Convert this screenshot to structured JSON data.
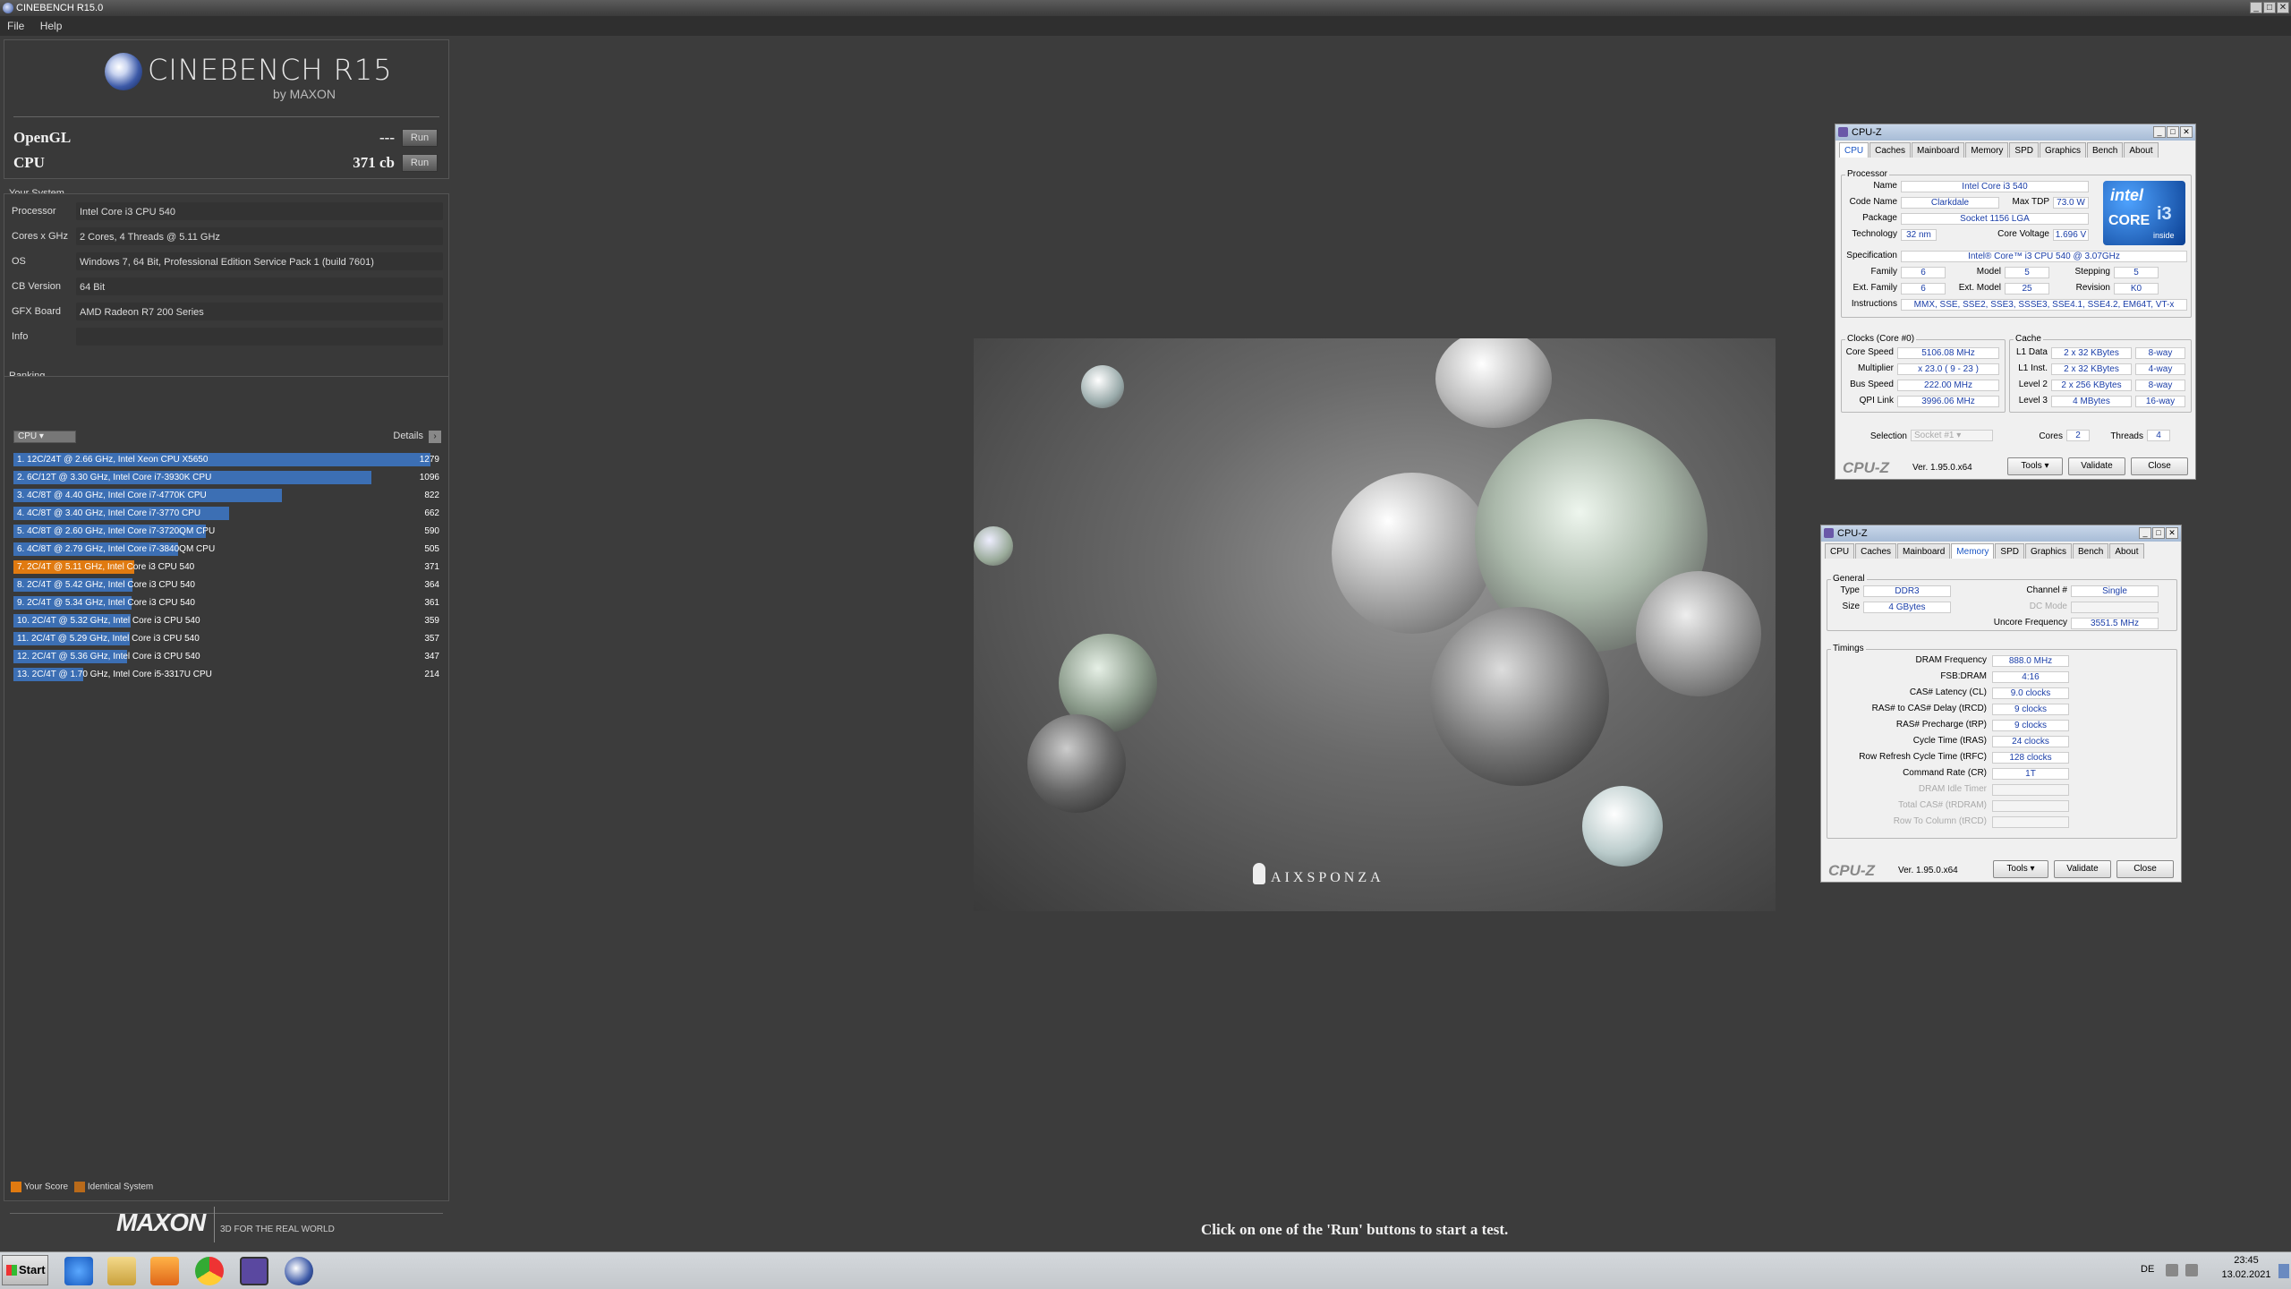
{
  "window": {
    "title": "CINEBENCH R15.0"
  },
  "menu": [
    "File",
    "Help"
  ],
  "logo": {
    "title": "CINEBENCH R15",
    "by": "by MAXON"
  },
  "bench": {
    "opengl": {
      "label": "OpenGL",
      "score": "---",
      "run": "Run"
    },
    "cpu": {
      "label": "CPU",
      "score": "371 cb",
      "run": "Run"
    }
  },
  "system": {
    "heading": "Your System",
    "rows": [
      {
        "k": "Processor",
        "v": "Intel Core i3 CPU 540"
      },
      {
        "k": "Cores x GHz",
        "v": "2 Cores, 4 Threads @ 5.11 GHz"
      },
      {
        "k": "OS",
        "v": "Windows 7, 64 Bit, Professional Edition Service Pack 1 (build 7601)"
      },
      {
        "k": "CB Version",
        "v": "64 Bit"
      },
      {
        "k": "GFX Board",
        "v": "AMD Radeon R7 200 Series"
      },
      {
        "k": "Info",
        "v": ""
      }
    ]
  },
  "ranking": {
    "heading": "Ranking",
    "selector": "CPU",
    "details": "Details",
    "max": 1279,
    "rows": [
      {
        "label": "1. 12C/24T @ 2.66 GHz, Intel Xeon CPU X5650",
        "score": 1279,
        "hl": false
      },
      {
        "label": "2. 6C/12T @ 3.30 GHz,  Intel Core i7-3930K CPU",
        "score": 1096,
        "hl": false
      },
      {
        "label": "3. 4C/8T @ 4.40 GHz, Intel Core i7-4770K CPU",
        "score": 822,
        "hl": false
      },
      {
        "label": "4. 4C/8T @ 3.40 GHz,  Intel Core i7-3770 CPU",
        "score": 662,
        "hl": false
      },
      {
        "label": "5. 4C/8T @ 2.60 GHz, Intel Core i7-3720QM CPU",
        "score": 590,
        "hl": false
      },
      {
        "label": "6. 4C/8T @ 2.79 GHz,  Intel Core i7-3840QM CPU",
        "score": 505,
        "hl": false
      },
      {
        "label": "7. 2C/4T @ 5.11 GHz, Intel Core i3 CPU 540",
        "score": 371,
        "hl": true
      },
      {
        "label": "8. 2C/4T @ 5.42 GHz, Intel Core i3 CPU 540",
        "score": 364,
        "hl": false
      },
      {
        "label": "9. 2C/4T @ 5.34 GHz, Intel Core i3 CPU 540",
        "score": 361,
        "hl": false
      },
      {
        "label": "10. 2C/4T @ 5.32 GHz, Intel Core i3 CPU 540",
        "score": 359,
        "hl": false
      },
      {
        "label": "11. 2C/4T @ 5.29 GHz, Intel Core i3 CPU 540",
        "score": 357,
        "hl": false
      },
      {
        "label": "12. 2C/4T @ 5.36 GHz, Intel Core i3 CPU 540",
        "score": 347,
        "hl": false
      },
      {
        "label": "13. 2C/4T @ 1.70 GHz,  Intel Core i5-3317U CPU",
        "score": 214,
        "hl": false
      }
    ],
    "legend_your": "Your Score",
    "legend_ident": "Identical System"
  },
  "footer": {
    "brand": "MAXON",
    "tagline": "3D FOR THE REAL WORLD",
    "status": "Click on one of the 'Run' buttons to start a test."
  },
  "render": {
    "watermark": "AIXSPONZA"
  },
  "cpuz_tabs": [
    "CPU",
    "Caches",
    "Mainboard",
    "Memory",
    "SPD",
    "Graphics",
    "Bench",
    "About"
  ],
  "cpuz1": {
    "title": "CPU-Z",
    "active_tab": "CPU",
    "processor": {
      "heading": "Processor",
      "name": "Intel Core i3 540",
      "code_name": "Clarkdale",
      "max_tdp": "73.0 W",
      "package": "Socket 1156 LGA",
      "technology": "32 nm",
      "core_voltage": "1.696 V",
      "specification": "Intel® Core™ i3 CPU        540  @ 3.07GHz",
      "family": "6",
      "model": "5",
      "stepping": "5",
      "ext_family": "6",
      "ext_model": "25",
      "revision": "K0",
      "instructions": "MMX, SSE, SSE2, SSE3, SSSE3, SSE4.1, SSE4.2, EM64T, VT-x"
    },
    "labels": {
      "name": "Name",
      "code_name": "Code Name",
      "max_tdp": "Max TDP",
      "package": "Package",
      "technology": "Technology",
      "core_voltage": "Core Voltage",
      "specification": "Specification",
      "family": "Family",
      "model": "Model",
      "stepping": "Stepping",
      "ext_family": "Ext. Family",
      "ext_model": "Ext. Model",
      "revision": "Revision",
      "instructions": "Instructions",
      "clocks": "Clocks (Core #0)",
      "core_speed": "Core Speed",
      "multiplier": "Multiplier",
      "bus_speed": "Bus Speed",
      "qpi": "QPI Link",
      "cache": "Cache",
      "l1d": "L1 Data",
      "l1i": "L1 Inst.",
      "l2": "Level 2",
      "l3": "Level 3",
      "selection": "Selection",
      "cores": "Cores",
      "threads": "Threads"
    },
    "clocks": {
      "core_speed": "5106.08 MHz",
      "multiplier": "x 23.0 ( 9 - 23 )",
      "bus_speed": "222.00 MHz",
      "qpi": "3996.06 MHz"
    },
    "cache": {
      "l1d": "2 x 32 KBytes",
      "l1d_way": "8-way",
      "l1i": "2 x 32 KBytes",
      "l1i_way": "4-way",
      "l2": "2 x 256 KBytes",
      "l2_way": "8-way",
      "l3": "4 MBytes",
      "l3_way": "16-way"
    },
    "selection": "Socket #1",
    "cores": "2",
    "threads": "4",
    "intel_badge": {
      "brand": "intel",
      "line": "CORE",
      "model": "i3",
      "inside": "inside"
    }
  },
  "cpuz2": {
    "title": "CPU-Z",
    "active_tab": "Memory",
    "general": {
      "heading": "General",
      "type_l": "Type",
      "type": "DDR3",
      "size_l": "Size",
      "size": "4 GBytes",
      "channel_l": "Channel #",
      "channel": "Single",
      "dc_l": "DC Mode",
      "dc": "",
      "uncore_l": "Uncore Frequency",
      "uncore": "3551.5 MHz"
    },
    "timings": {
      "heading": "Timings",
      "rows": [
        {
          "k": "DRAM Frequency",
          "v": "888.0 MHz",
          "dis": false
        },
        {
          "k": "FSB:DRAM",
          "v": "4:16",
          "dis": false
        },
        {
          "k": "CAS# Latency (CL)",
          "v": "9.0 clocks",
          "dis": false
        },
        {
          "k": "RAS# to CAS# Delay (tRCD)",
          "v": "9 clocks",
          "dis": false
        },
        {
          "k": "RAS# Precharge (tRP)",
          "v": "9 clocks",
          "dis": false
        },
        {
          "k": "Cycle Time (tRAS)",
          "v": "24 clocks",
          "dis": false
        },
        {
          "k": "Row Refresh Cycle Time (tRFC)",
          "v": "128 clocks",
          "dis": false
        },
        {
          "k": "Command Rate (CR)",
          "v": "1T",
          "dis": false
        },
        {
          "k": "DRAM Idle Timer",
          "v": "",
          "dis": true
        },
        {
          "k": "Total CAS# (tRDRAM)",
          "v": "",
          "dis": true
        },
        {
          "k": "Row To Column (tRCD)",
          "v": "",
          "dis": true
        }
      ]
    }
  },
  "cpuz_footer": {
    "brand": "CPU-Z",
    "version": "Ver. 1.95.0.x64",
    "tools": "Tools",
    "validate": "Validate",
    "close": "Close"
  },
  "taskbar": {
    "start": "Start",
    "lang": "DE",
    "time": "23:45",
    "date": "13.02.2021"
  }
}
